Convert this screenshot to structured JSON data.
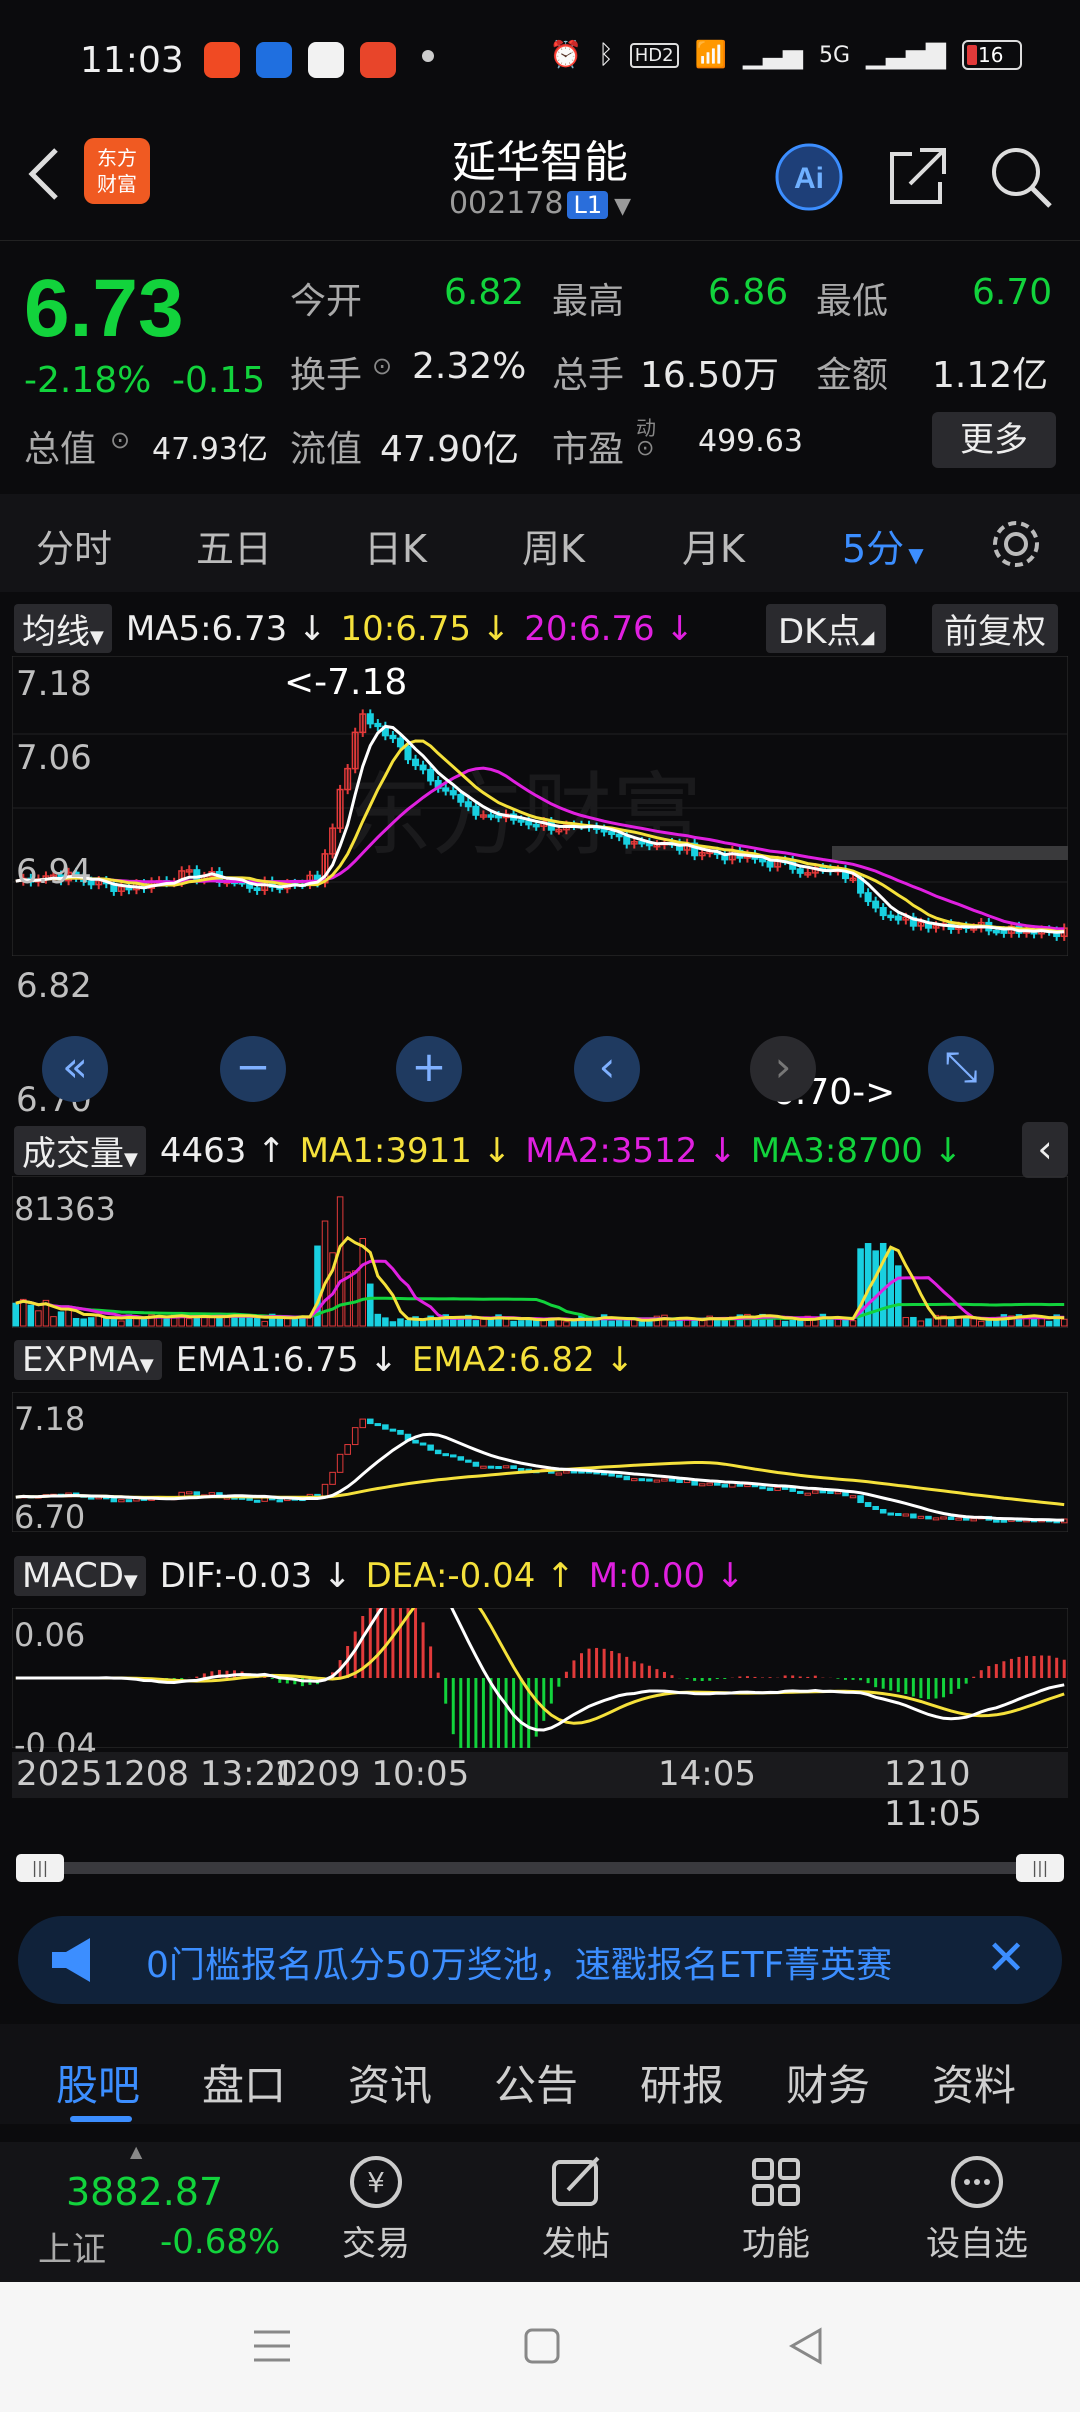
{
  "status": {
    "time": "11:03",
    "battery": "16",
    "net_hd": "HD2",
    "net_5g": "5G"
  },
  "header": {
    "title": "延华智能",
    "code": "002178",
    "level": "L1",
    "logo_line1": "东方",
    "logo_line2": "财富",
    "ai_label": "Ai"
  },
  "quote": {
    "price": "6.73",
    "change_pct": "-2.18%",
    "change": "-0.15",
    "open_label": "今开",
    "open": "6.82",
    "high_label": "最高",
    "high": "6.86",
    "low_label": "最低",
    "low": "6.70",
    "turnover_label": "换手",
    "turnover": "2.32%",
    "volume_label": "总手",
    "volume": "16.50万",
    "amount_label": "金额",
    "amount": "1.12亿",
    "mktcap_label": "总值",
    "mktcap": "47.93亿",
    "float_label": "流值",
    "float": "47.90亿",
    "pe_label": "市盈",
    "pe_sup": "动",
    "pe": "499.63",
    "more_label": "更多"
  },
  "period_tabs": [
    "分时",
    "五日",
    "日K",
    "周K",
    "月K",
    "5分"
  ],
  "main_chart": {
    "indicator": "均线",
    "ma5": "MA5:6.73",
    "ma10": "10:6.75",
    "ma20": "20:6.76",
    "dk_label": "DK点",
    "adjust_label": "前复权",
    "y_labels": [
      "7.18",
      "7.06",
      "6.94",
      "6.82",
      "6.70"
    ],
    "high_marker": "<-7.18",
    "low_marker": "6.70->",
    "watermark": "东方财富"
  },
  "volume_chart": {
    "indicator": "成交量",
    "value": "4463",
    "ma1": "MA1:3911",
    "ma2": "MA2:3512",
    "ma3": "MA3:8700",
    "y_label": "81363"
  },
  "expma_chart": {
    "indicator": "EXPMA",
    "ema1": "EMA1:6.75",
    "ema2": "EMA2:6.82",
    "y_top": "7.18",
    "y_bottom": "6.70"
  },
  "macd_chart": {
    "indicator": "MACD",
    "dif": "DIF:-0.03",
    "dea": "DEA:-0.04",
    "m": "M:0.00",
    "y_top": "0.06",
    "y_bottom": "-0.04"
  },
  "time_axis": {
    "left": "20251208 13:20",
    "mid1": "1209 10:05",
    "mid2": "14:05",
    "right": "1210 11:05"
  },
  "chart_data": {
    "type": "candlestick",
    "ylim": [
      6.7,
      7.18
    ],
    "series": [
      {
        "name": "MA5",
        "value": "6.73"
      },
      {
        "name": "MA10",
        "value": "6.75"
      },
      {
        "name": "MA20",
        "value": "6.76"
      }
    ]
  },
  "banner": {
    "text": "0门槛报名瓜分50万奖池，速戳报名ETF菁英赛"
  },
  "bottom_tabs": [
    "股吧",
    "盘口",
    "资讯",
    "公告",
    "研报",
    "财务",
    "资料"
  ],
  "index": {
    "value": "3882.87",
    "name": "上证",
    "change": "-0.68%"
  },
  "bottom_actions": [
    "交易",
    "发帖",
    "功能",
    "设自选"
  ],
  "colors": {
    "green": "#12d33c",
    "red": "#e23a3a",
    "blue": "#3c8eff",
    "yellow": "#f5e13b",
    "magenta": "#e020e0"
  }
}
